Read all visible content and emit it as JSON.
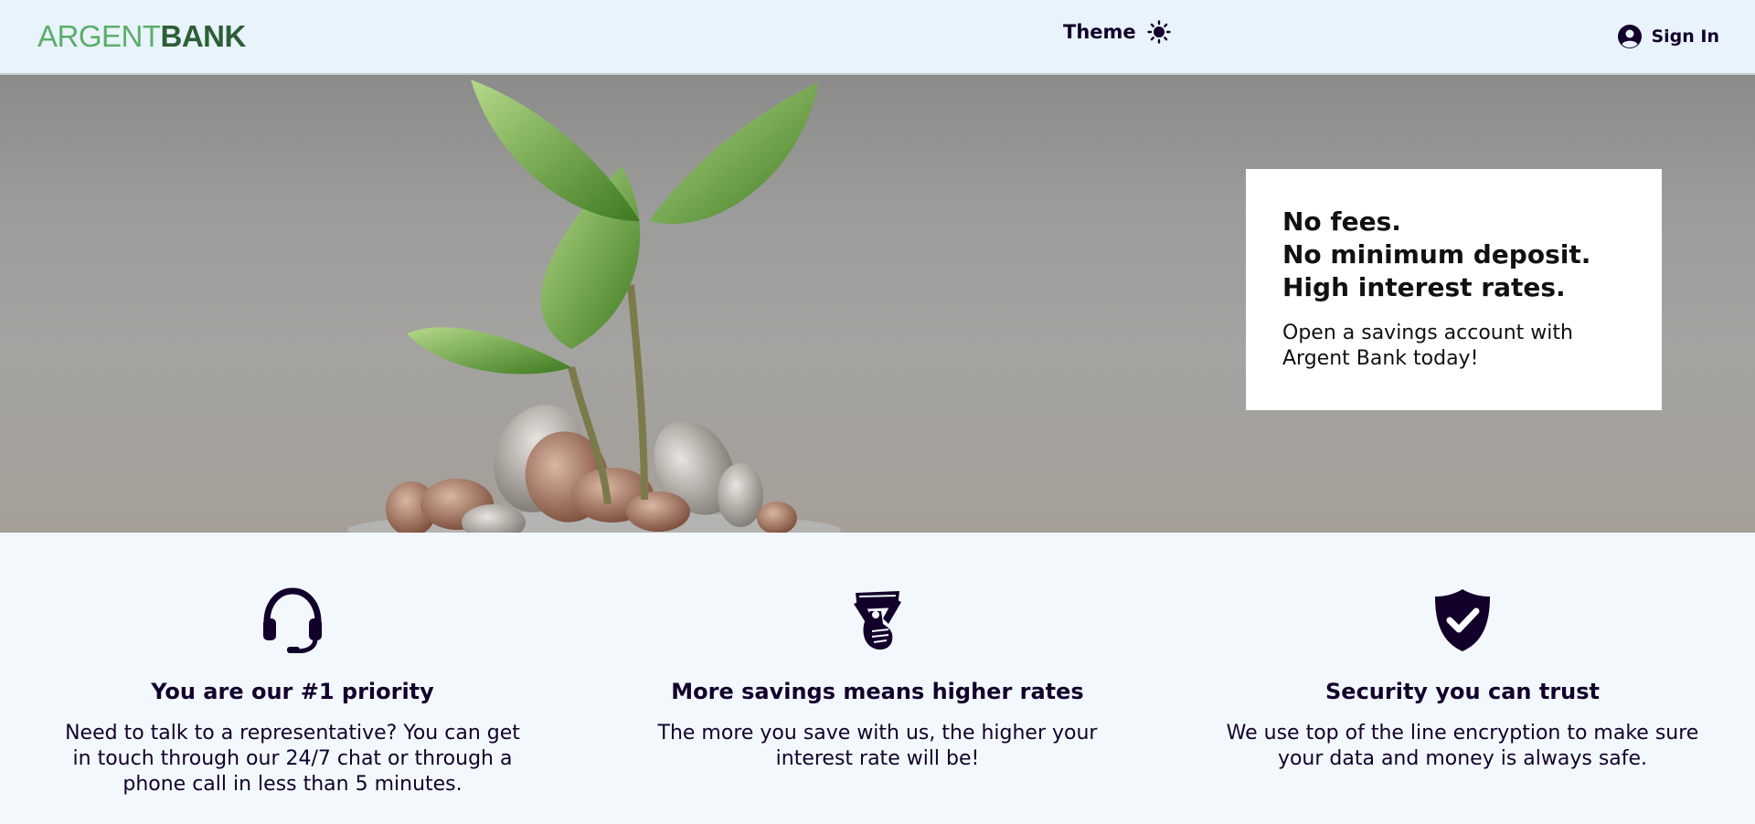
{
  "navbar": {
    "logo_light": "ARGENT",
    "logo_dark": "BANK",
    "theme_label": "Theme",
    "theme_icon": "sun-icon",
    "signin_label": "Sign In",
    "signin_icon": "user-circle-icon"
  },
  "hero": {
    "subtitles": [
      "No fees.",
      "No minimum deposit.",
      "High interest rates."
    ],
    "text": "Open a savings account with Argent Bank today!",
    "image": "plant-growing-from-coins"
  },
  "features": [
    {
      "icon": "headset-icon",
      "title": "You are our #1 priority",
      "text": "Need to talk to a representative? You can get in touch through our 24/7 chat or through a phone call in less than 5 minutes."
    },
    {
      "icon": "money-icon",
      "title": "More savings means higher rates",
      "text": "The more you save with us, the higher your interest rate will be!"
    },
    {
      "icon": "shield-check-icon",
      "title": "Security you can trust",
      "text": "We use top of the line encryption to make sure your data and money is always safe."
    }
  ],
  "colors": {
    "navbar_bg": "#e9f3fb",
    "logo_light": "#5cae6a",
    "logo_dark": "#2c5f37",
    "text_dark": "#12002b",
    "features_bg": "#f3f8fd"
  }
}
